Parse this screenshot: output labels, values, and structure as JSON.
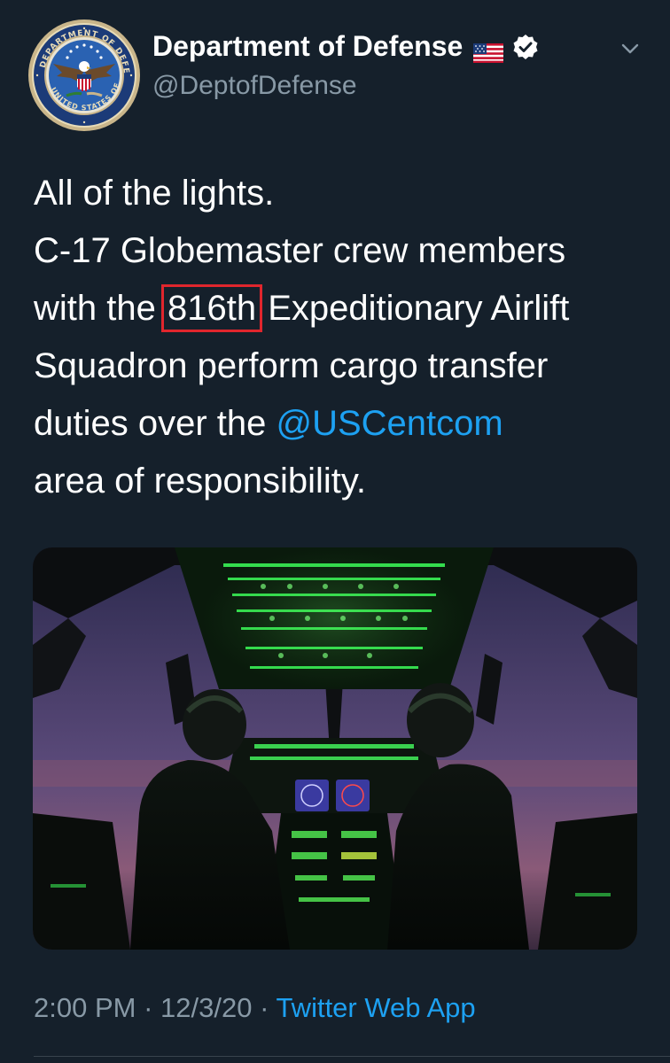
{
  "account": {
    "display_name": "Department of Defense",
    "handle": "@DeptofDefense",
    "flag_emoji": "🇺🇸",
    "verified": true,
    "seal_text": "DEPARTMENT OF DEFENSE • UNITED STATES OF AMERICA"
  },
  "tweet": {
    "lines": {
      "l1": "All of the lights.",
      "l2": "C-17 Globemaster crew members",
      "l3_before": "with the ",
      "l3_highlight": "816th",
      "l3_after": " Expeditionary Airlift",
      "l4": "Squadron perform cargo transfer",
      "l5_before": "duties over the ",
      "l5_mention": "@USCentcom",
      "l6": "area of responsibility."
    },
    "highlight_color": "#e0262d",
    "mention_color": "#1da1f2"
  },
  "meta": {
    "time": "2:00 PM",
    "separator": " · ",
    "date": "12/3/20",
    "source": "Twitter Web App"
  },
  "icons": {
    "avatar": "dod-seal-icon",
    "verified": "verified-badge-icon",
    "menu": "chevron-down-icon",
    "flag": "us-flag-icon"
  }
}
